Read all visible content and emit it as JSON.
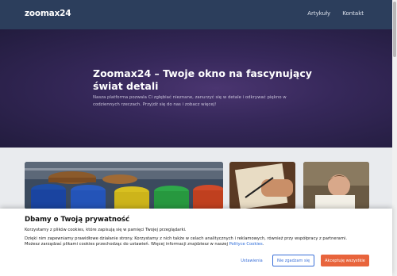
{
  "header": {
    "logo": "zoomax24",
    "nav": [
      {
        "label": "Artykuły"
      },
      {
        "label": "Kontakt"
      }
    ]
  },
  "hero": {
    "title": "Zoomax24 – Twoje okno na fascynujący świat detali",
    "description": "Nasza platforma pozwala Ci zgłębiać nieznane, zanurzyć się w detale i odkrywać piękno w codziennych rzeczach. Przyjdź się do nas i zobacz więcej!"
  },
  "cards": [
    {
      "subject": "colorful-barrels-warehouse"
    },
    {
      "subject": "hands-writing-on-paper"
    },
    {
      "subject": "child-with-book"
    }
  ],
  "cookie": {
    "title": "Dbamy o Twoją prywatność",
    "line1": "Korzystamy z plików cookies, które zapisują się w pamięci Twojej przeglądarki.",
    "line2": "Dzięki nim zapewniamy prawidłowe działanie strony. Korzystamy z nich także w celach analitycznych i reklamowych, również przy współpracy z partnerami.",
    "line3_text": "Możesz zarządzać plikami cookies przechodząc do ustawień. Więcej informacji znajdziesz w naszej ",
    "line3_link": "Polityce Cookies",
    "line3_end": ".",
    "buttons": {
      "settings": "Ustawienia",
      "reject": "Nie zgadzam się",
      "accept": "Akceptuję wszystkie"
    }
  },
  "colors": {
    "header_bg": "#2c3e5c",
    "hero_bg": "#36285a",
    "accent_button": "#e8643c",
    "link": "#3a6fd8"
  }
}
